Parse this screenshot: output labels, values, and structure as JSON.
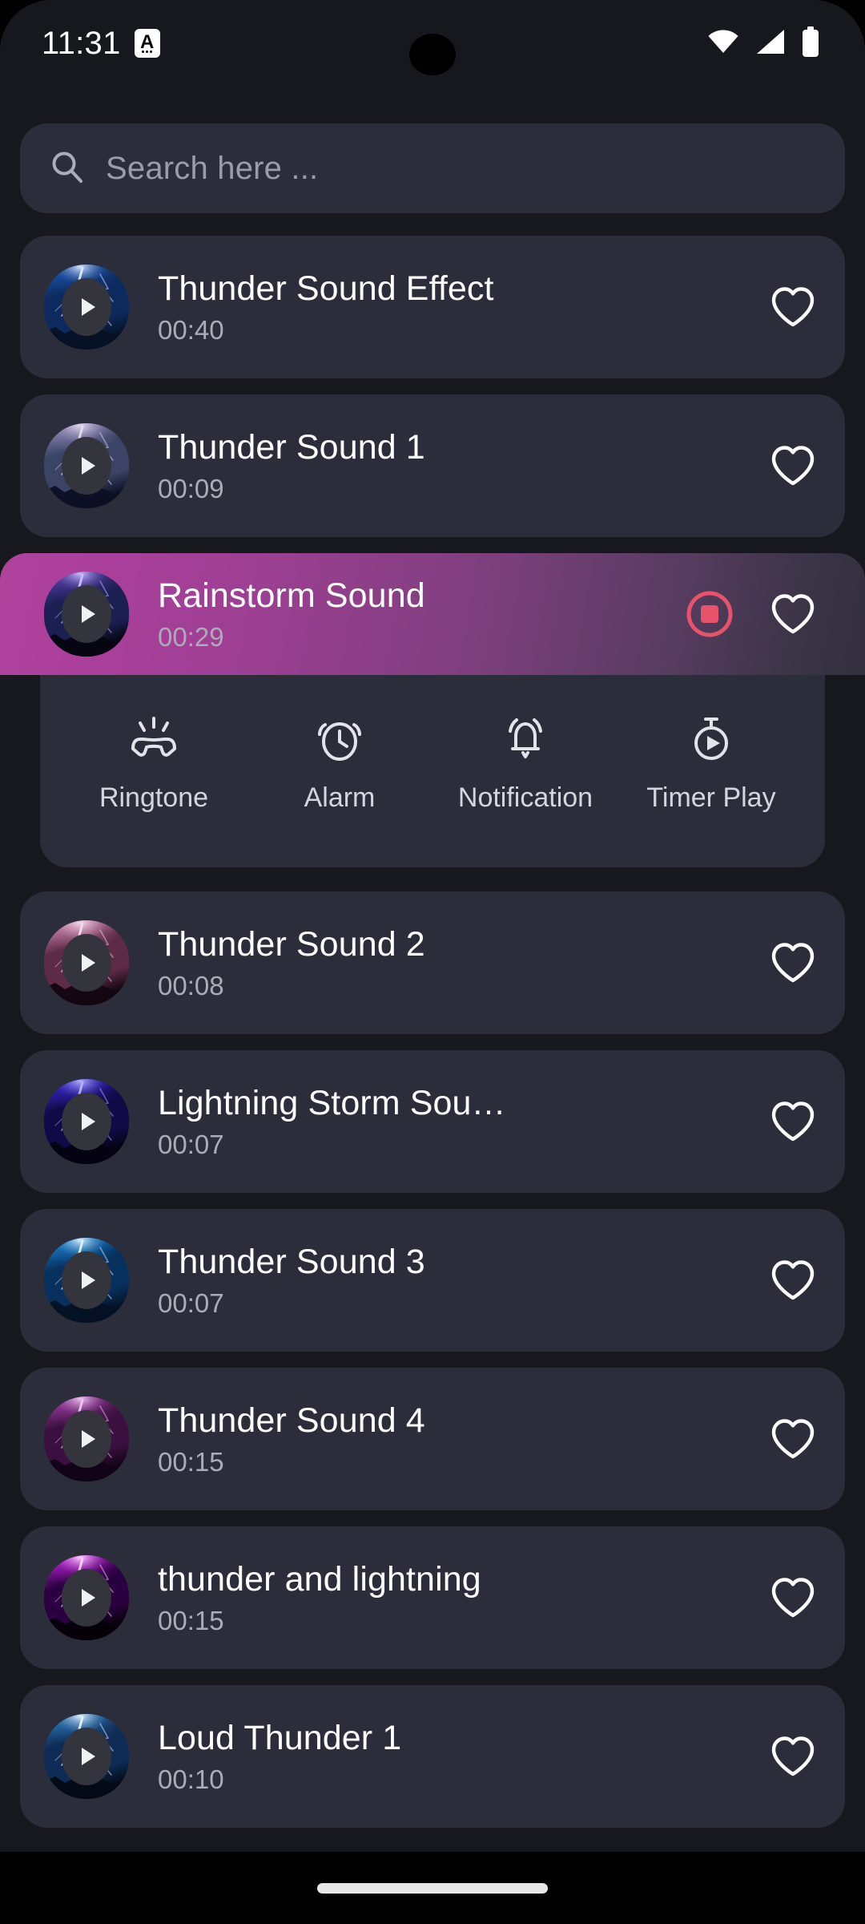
{
  "status_bar": {
    "time": "11:31",
    "app_badge_glyph": "A",
    "icons": [
      "wifi-icon",
      "cellular-signal-icon",
      "battery-icon"
    ]
  },
  "search": {
    "icon": "search-icon",
    "placeholder": "Search here ...",
    "value": ""
  },
  "colors": {
    "page_background": "#17181d",
    "card_background": "#2b2e3a",
    "active_gradient_start": "#b0439c",
    "active_gradient_end": "#33303f",
    "stop_button": "#e8536b",
    "title_text": "#ffffff",
    "secondary_text": "#aaacb6"
  },
  "action_panel": {
    "items": [
      {
        "label": "Ringtone",
        "icon": "phone-ringing-icon"
      },
      {
        "label": "Alarm",
        "icon": "alarm-clock-icon"
      },
      {
        "label": "Notification",
        "icon": "bell-icon"
      },
      {
        "label": "Timer Play",
        "icon": "stopwatch-play-icon"
      }
    ]
  },
  "list": {
    "items": [
      {
        "title": "Thunder Sound Effect",
        "duration": "00:40",
        "favorite": false,
        "active": false,
        "art": "thunder-navy"
      },
      {
        "title": "Thunder Sound 1",
        "duration": "00:09",
        "favorite": false,
        "active": false,
        "art": "thunder-mauve"
      },
      {
        "title": "Rainstorm Sound",
        "duration": "00:29",
        "favorite": false,
        "active": true,
        "art": "thunder-indigo"
      },
      {
        "title": "Thunder Sound 2",
        "duration": "00:08",
        "favorite": false,
        "active": false,
        "art": "thunder-pink"
      },
      {
        "title": "Lightning Storm Sou…",
        "duration": "00:07",
        "favorite": false,
        "active": false,
        "art": "thunder-blueviolet"
      },
      {
        "title": "Thunder Sound 3",
        "duration": "00:07",
        "favorite": false,
        "active": false,
        "art": "thunder-cyan"
      },
      {
        "title": "Thunder Sound 4",
        "duration": "00:15",
        "favorite": false,
        "active": false,
        "art": "thunder-purple"
      },
      {
        "title": "thunder and lightning",
        "duration": "00:15",
        "favorite": false,
        "active": false,
        "art": "thunder-magenta"
      },
      {
        "title": "Loud Thunder 1",
        "duration": "00:10",
        "favorite": false,
        "active": false,
        "art": "thunder-steelblue"
      }
    ]
  },
  "nav_bar": {
    "gesture_pill": "home-gesture-pill"
  }
}
